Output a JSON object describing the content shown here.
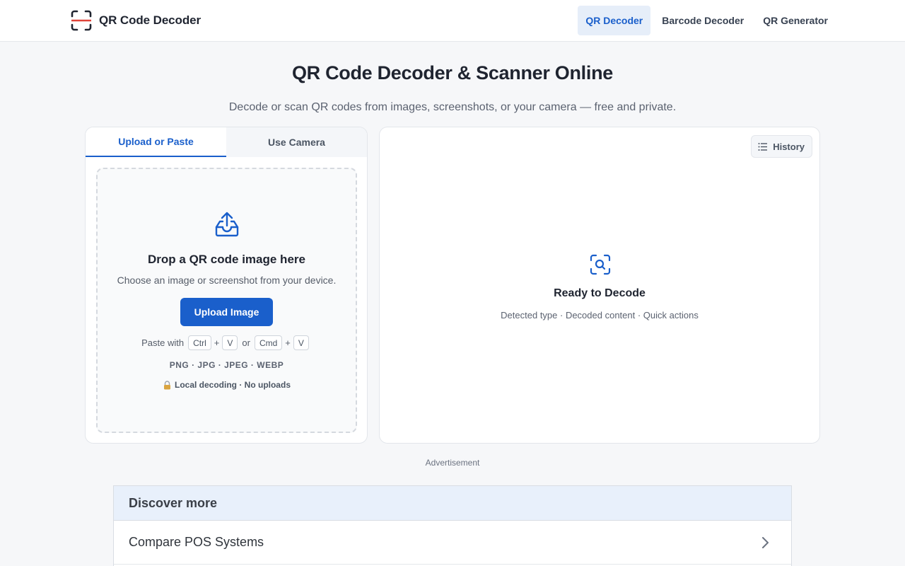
{
  "header": {
    "brand_name": "QR Code Decoder",
    "nav": [
      {
        "label": "QR Decoder",
        "active": true
      },
      {
        "label": "Barcode Decoder",
        "active": false
      },
      {
        "label": "QR Generator",
        "active": false
      }
    ]
  },
  "hero": {
    "title": "QR Code Decoder & Scanner Online",
    "subtitle": "Decode or scan QR codes from images, screenshots, or your camera — free and private."
  },
  "input_panel": {
    "tabs": [
      {
        "label": "Upload or Paste",
        "active": true
      },
      {
        "label": "Use Camera",
        "active": false
      }
    ],
    "dropzone": {
      "title": "Drop a QR code image here",
      "subtitle": "Choose an image or screenshot from your device.",
      "button_label": "Upload Image",
      "paste_prefix": "Paste with",
      "key_ctrl": "Ctrl",
      "key_v": "V",
      "key_cmd": "Cmd",
      "plus": "+",
      "or": "or",
      "formats": "PNG · JPG · JPEG · WEBP",
      "privacy": "Local decoding · No uploads"
    }
  },
  "result_panel": {
    "history_label": "History",
    "ready_title": "Ready to Decode",
    "ready_subtitle": "Detected type · Decoded content · Quick actions"
  },
  "ad_label": "Advertisement",
  "discover": {
    "title": "Discover more",
    "items": [
      "Compare POS Systems"
    ]
  },
  "colors": {
    "accent": "#1a5fcb",
    "brand_red": "#e0453a",
    "background": "#f6f7f9"
  },
  "icons": [
    "scan-frame-icon",
    "upload-tray-icon",
    "lock-icon",
    "list-icon",
    "scan-search-icon",
    "chevron-right-icon"
  ]
}
